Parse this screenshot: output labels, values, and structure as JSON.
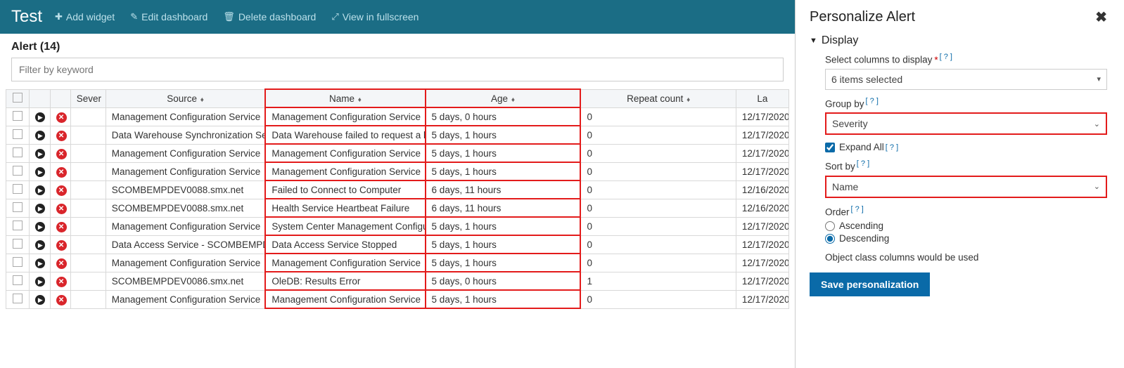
{
  "topbar": {
    "title": "Test",
    "add_widget": "Add widget",
    "edit_dashboard": "Edit dashboard",
    "delete_dashboard": "Delete dashboard",
    "view_fullscreen": "View in fullscreen"
  },
  "alert_header": "Alert (14)",
  "filter_placeholder": "Filter by keyword",
  "columns": {
    "severity": "Sever",
    "source": "Source",
    "name": "Name",
    "age": "Age",
    "repeat": "Repeat count",
    "last": "La"
  },
  "rows": [
    {
      "source": "Management Configuration Service",
      "name": "Management Configuration Service ",
      "age": "5 days, 0 hours",
      "repeat": "0",
      "last": "12/17/2020"
    },
    {
      "source": "Data Warehouse Synchronization Se",
      "name": "Data Warehouse failed to request a l",
      "age": "5 days, 1 hours",
      "repeat": "0",
      "last": "12/17/2020"
    },
    {
      "source": "Management Configuration Service",
      "name": "Management Configuration Service ",
      "age": "5 days, 1 hours",
      "repeat": "0",
      "last": "12/17/2020"
    },
    {
      "source": "Management Configuration Service",
      "name": "Management Configuration Service ",
      "age": "5 days, 1 hours",
      "repeat": "0",
      "last": "12/17/2020"
    },
    {
      "source": "SCOMBEMPDEV0088.smx.net",
      "name": "Failed to Connect to Computer",
      "age": "6 days, 11 hours",
      "repeat": "0",
      "last": "12/16/2020"
    },
    {
      "source": "SCOMBEMPDEV0088.smx.net",
      "name": "Health Service Heartbeat Failure",
      "age": "6 days, 11 hours",
      "repeat": "0",
      "last": "12/16/2020"
    },
    {
      "source": "Management Configuration Service",
      "name": "System Center Management Configu",
      "age": "5 days, 1 hours",
      "repeat": "0",
      "last": "12/17/2020"
    },
    {
      "source": "Data Access Service - SCOMBEMPDE",
      "name": "Data Access Service Stopped",
      "age": "5 days, 1 hours",
      "repeat": "0",
      "last": "12/17/2020"
    },
    {
      "source": "Management Configuration Service",
      "name": "Management Configuration Service ",
      "age": "5 days, 1 hours",
      "repeat": "0",
      "last": "12/17/2020"
    },
    {
      "source": "SCOMBEMPDEV0086.smx.net",
      "name": "OleDB: Results Error",
      "age": "5 days, 0 hours",
      "repeat": "1",
      "last": "12/17/2020"
    },
    {
      "source": "Management Configuration Service",
      "name": "Management Configuration Service ",
      "age": "5 days, 1 hours",
      "repeat": "0",
      "last": "12/17/2020"
    }
  ],
  "panel": {
    "title": "Personalize Alert",
    "display": "Display",
    "select_cols_label": "Select columns to display",
    "cols_selected": "6 items selected",
    "group_by_label": "Group by",
    "group_by_value": "Severity",
    "expand_all": "Expand All",
    "sort_by_label": "Sort by",
    "sort_by_value": "Name",
    "order_label": "Order",
    "asc": "Ascending",
    "desc": "Descending",
    "note": "Object class columns would be used",
    "save": "Save personalization",
    "help": "[ ? ]"
  }
}
